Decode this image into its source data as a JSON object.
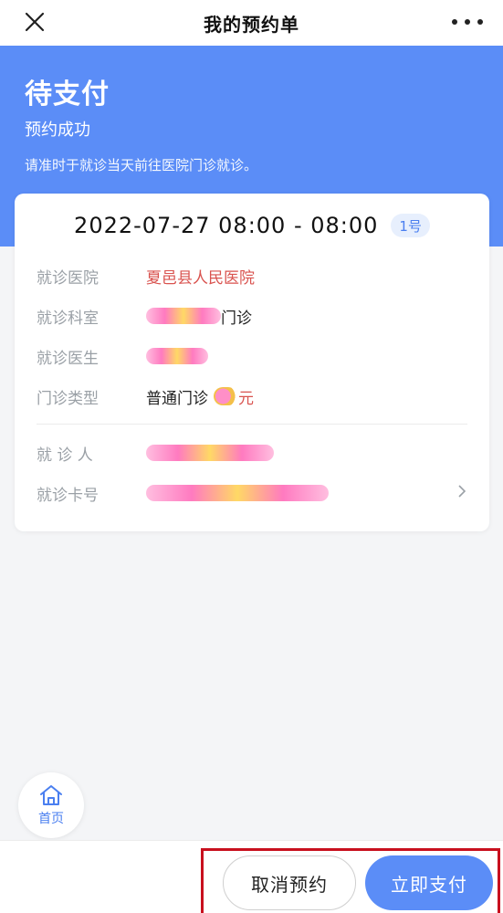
{
  "nav": {
    "title": "我的预约单",
    "close_icon": "close-icon",
    "more_icon": "more-icon"
  },
  "header": {
    "status": "待支付",
    "subtitle": "预约成功",
    "tip": "请准时于就诊当天前往医院门诊就诊。"
  },
  "appointment": {
    "time": "2022-07-27 08:00 - 08:00",
    "number_badge": "1号",
    "rows": [
      {
        "label": "就诊医院",
        "value": "夏邑县人民医院"
      },
      {
        "label": "就诊科室",
        "value": "门诊"
      },
      {
        "label": "就诊医生",
        "value": ""
      },
      {
        "label": "门诊类型",
        "value": "普通门诊",
        "price_unit": "元"
      },
      {
        "label": "就 诊 人",
        "value": ""
      },
      {
        "label": "就诊卡号",
        "value": ""
      }
    ]
  },
  "home": {
    "label": "首页",
    "icon": "home-icon"
  },
  "actions": {
    "cancel_label": "取消预约",
    "pay_label": "立即支付"
  },
  "colors": {
    "brand_blue": "#5b8df7",
    "hospital_red": "#d9534f",
    "highlight_red": "#c8101e"
  }
}
